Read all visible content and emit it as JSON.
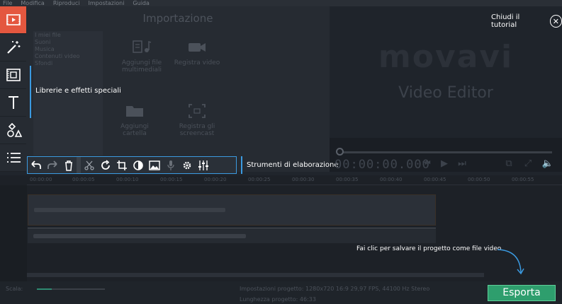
{
  "menu": [
    "File",
    "Modifica",
    "Riproduci",
    "Impostazioni",
    "Guida"
  ],
  "library": {
    "title": "Importazione",
    "items": [
      "I miei file",
      "Suoni",
      "Musica",
      "Contenuti video",
      "Sfondi"
    ],
    "tiles": [
      {
        "line1": "Aggiungi file",
        "line2": "multimediali",
        "icon": "add-media-icon"
      },
      {
        "line1": "Registra video",
        "line2": "",
        "icon": "camera-icon"
      },
      {
        "line1": "Aggiungi",
        "line2": "cartella",
        "icon": "folder-icon"
      },
      {
        "line1": "Registra gli",
        "line2": "screencast",
        "icon": "screencast-icon"
      }
    ]
  },
  "preview": {
    "logo": "movavi",
    "subtitle": "Video Editor",
    "timecode": "00:00:00.000"
  },
  "tutorial": {
    "close_label": "Chiudi il tutorial",
    "libraries_label": "Librerie e effetti speciali",
    "tools_label": "Strumenti di elaborazione",
    "export_hint": "Fai clic per salvare il progetto come file video"
  },
  "ruler": [
    "00:00:00",
    "00:00:05",
    "00:00:10",
    "00:00:15",
    "00:00:20",
    "00:00:25",
    "00:00:30",
    "00:00:35",
    "00:00:40",
    "00:00:45",
    "00:00:50",
    "00:00:55"
  ],
  "bottom": {
    "scale_label": "Scala:",
    "zoom_level": 0.22,
    "project_settings": "Impostazioni progetto:  1280x720 16:9 29,97 FPS, 44100 Hz Stereo",
    "project_length": "Lunghezza progetto:   46:33",
    "export_label": "Esporta"
  },
  "colors": {
    "accent": "#e4573f",
    "highlight": "#3b9ae0",
    "export": "#2e9e6d"
  }
}
